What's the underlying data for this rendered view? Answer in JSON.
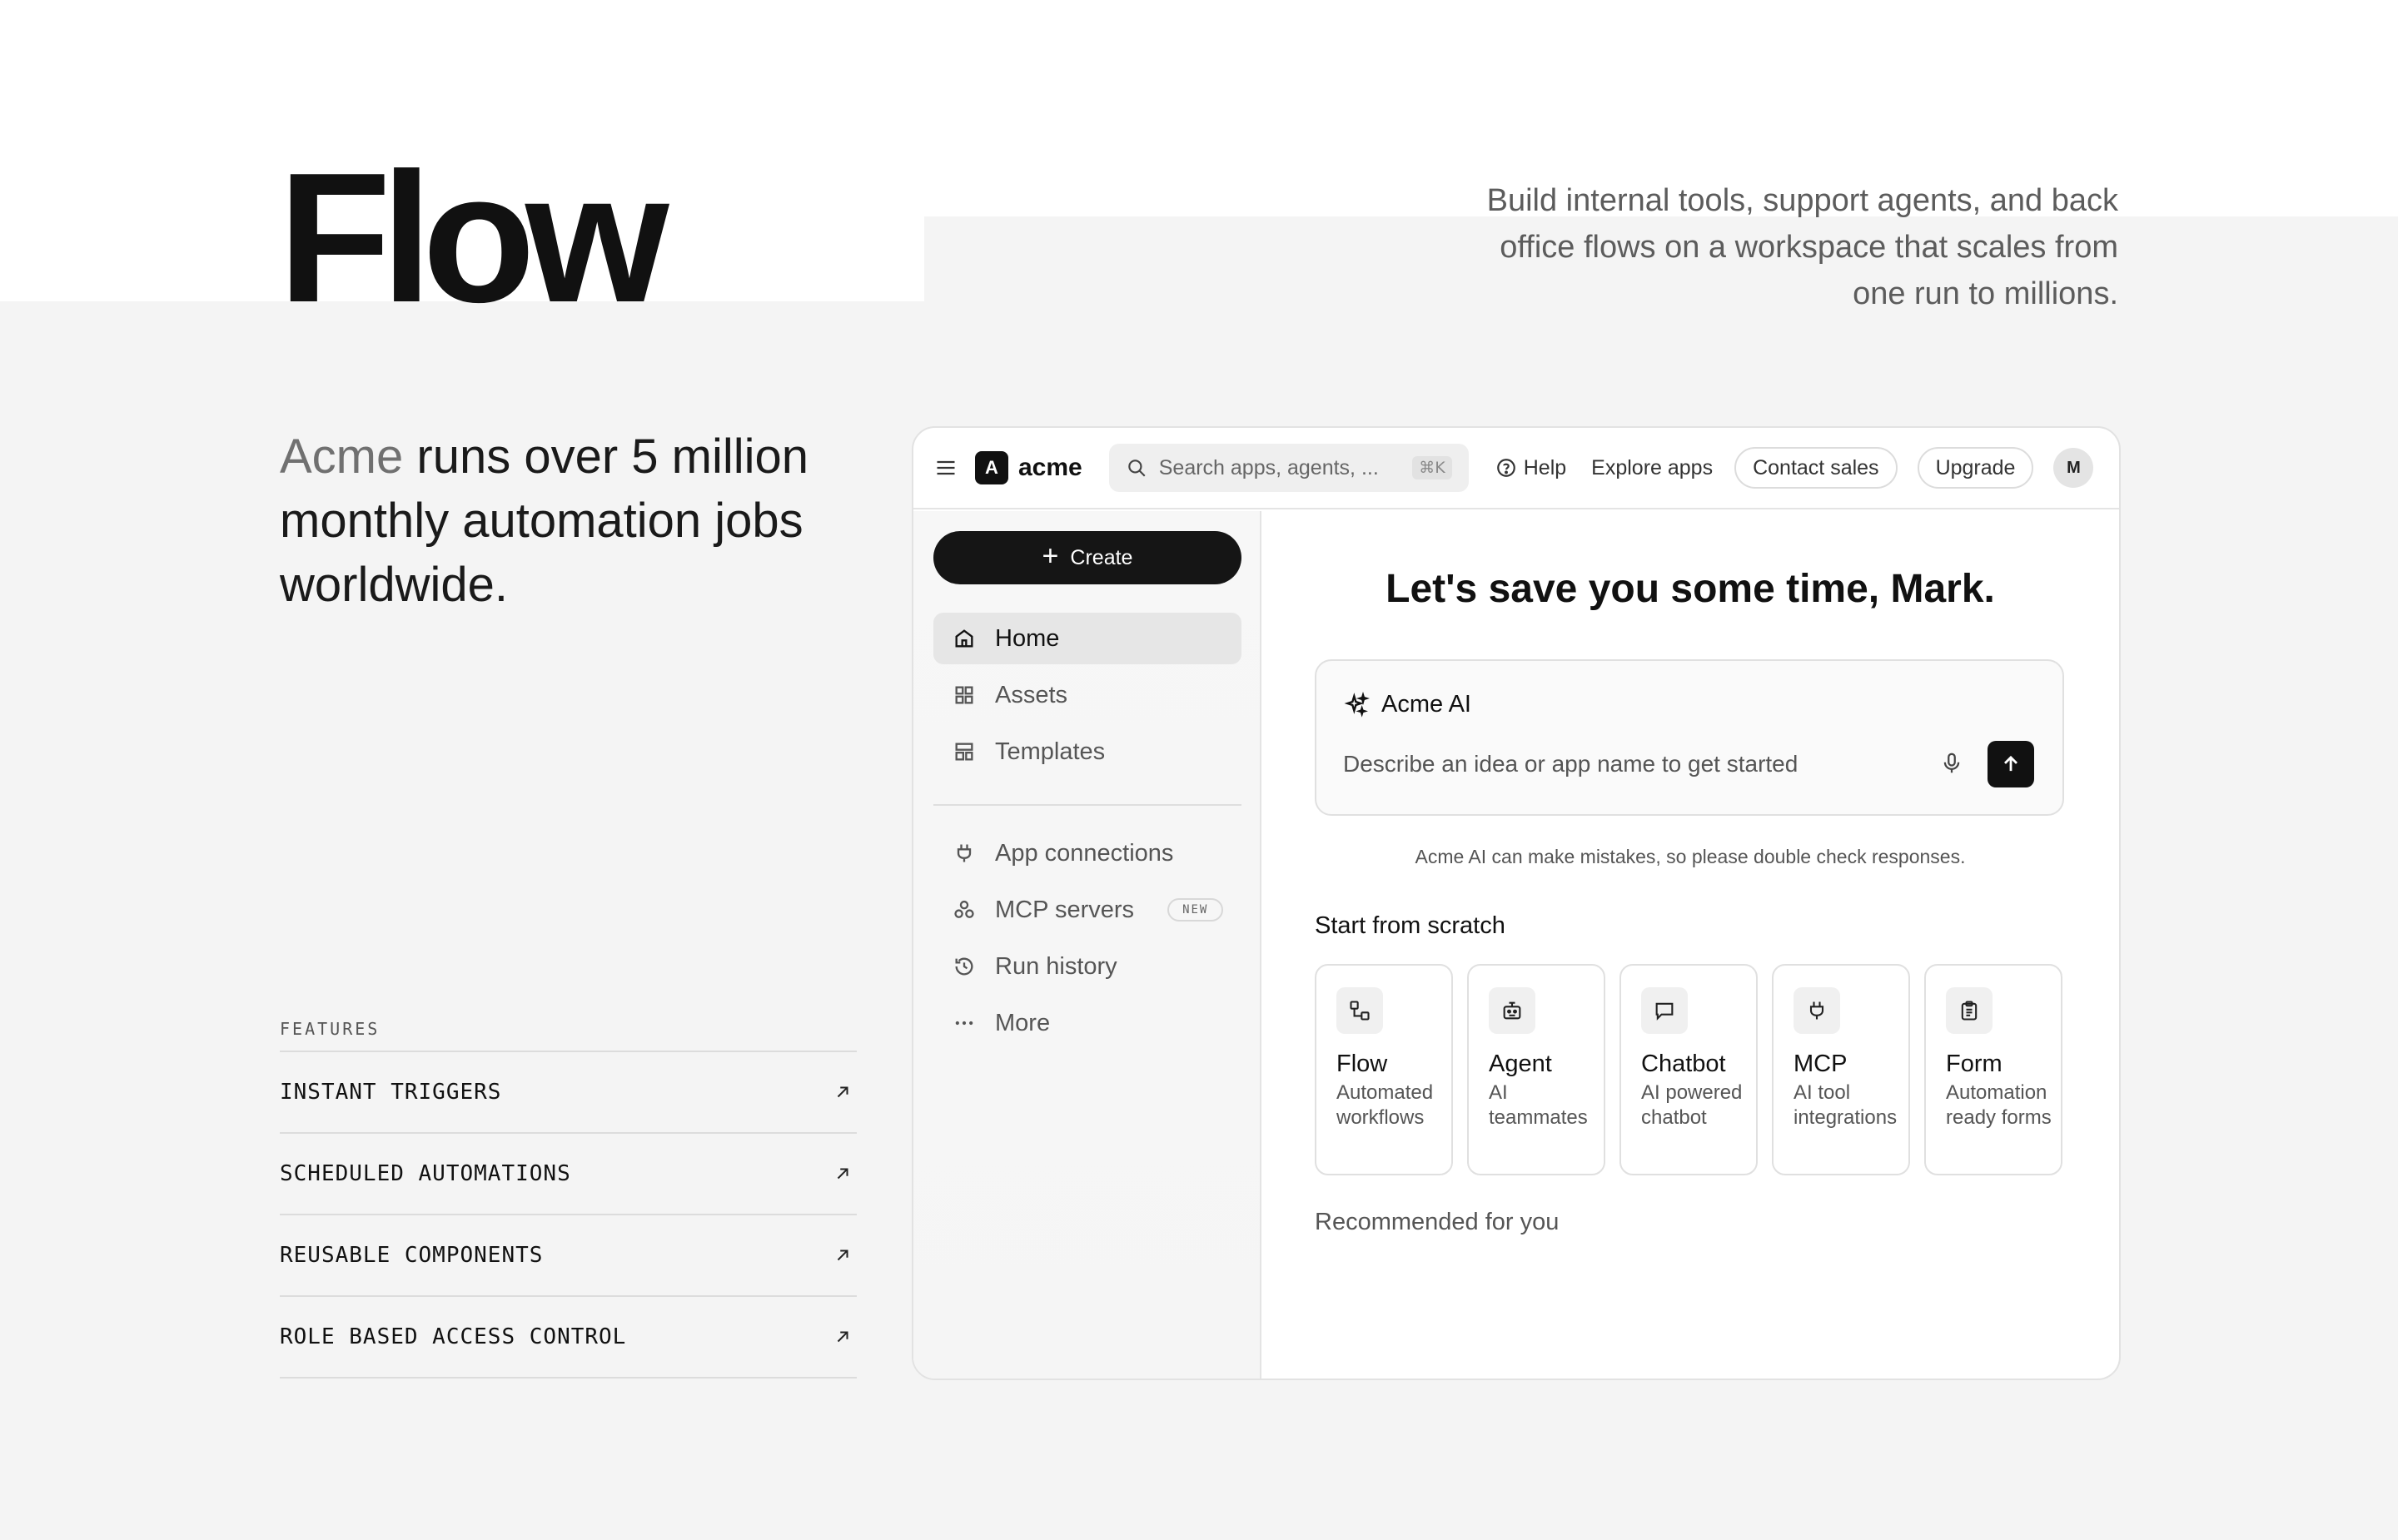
{
  "hero": {
    "title": "Flow",
    "description": "Build internal tools, support agents, and back office flows on a workspace that scales from one run to millions."
  },
  "headline": {
    "brand": "Acme",
    "rest": " runs over 5 million monthly automation jobs worldwide."
  },
  "features": {
    "label": "FEATURES",
    "items": [
      {
        "label": "INSTANT TRIGGERS"
      },
      {
        "label": "SCHEDULED AUTOMATIONS"
      },
      {
        "label": "REUSABLE COMPONENTS"
      },
      {
        "label": "ROLE BASED ACCESS CONTROL"
      }
    ]
  },
  "topbar": {
    "logo_letter": "A",
    "logo_text": "acme",
    "search_placeholder": "Search apps, agents, ...",
    "search_shortcut": "⌘K",
    "help": "Help",
    "explore": "Explore apps",
    "contact": "Contact sales",
    "upgrade": "Upgrade",
    "avatar": "M"
  },
  "sidebar": {
    "create": "Create",
    "items": [
      {
        "label": "Home",
        "icon": "home-icon"
      },
      {
        "label": "Assets",
        "icon": "grid-icon"
      },
      {
        "label": "Templates",
        "icon": "layout-icon"
      },
      {
        "label": "App connections",
        "icon": "plug-icon"
      },
      {
        "label": "MCP servers",
        "icon": "network-icon",
        "badge": "NEW"
      },
      {
        "label": "Run history",
        "icon": "history-icon"
      },
      {
        "label": "More",
        "icon": "more-icon"
      }
    ]
  },
  "main": {
    "greeting": "Let's save you some time, Mark.",
    "ai_title": "Acme AI",
    "ai_placeholder": "Describe an idea or app name to get started",
    "disclaimer": "Acme AI can make mistakes, so please double check responses.",
    "scratch_title": "Start from scratch",
    "cards": [
      {
        "title": "Flow",
        "desc": "Automated workflows",
        "icon": "flow-icon"
      },
      {
        "title": "Agent",
        "desc": "AI teammates",
        "icon": "robot-icon"
      },
      {
        "title": "Chatbot",
        "desc": "AI powered chatbot",
        "icon": "chat-icon"
      },
      {
        "title": "MCP",
        "desc": "AI tool integrations",
        "icon": "plug-icon"
      },
      {
        "title": "Form",
        "desc": "Automation ready forms",
        "icon": "clipboard-icon"
      }
    ],
    "recommended": "Recommended for you"
  }
}
